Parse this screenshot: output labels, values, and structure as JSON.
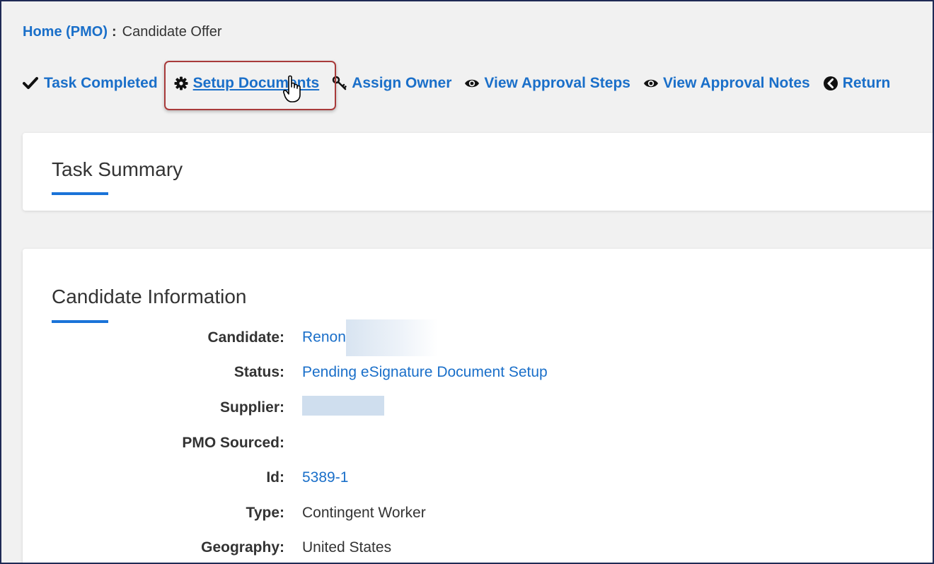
{
  "breadcrumb": {
    "home_label": "Home (PMO)",
    "separator": ":",
    "current": "Candidate Offer"
  },
  "actions": [
    {
      "label": "Task Completed",
      "icon": "checkmark-icon"
    },
    {
      "label": "Setup Documents",
      "icon": "gear-icon"
    },
    {
      "label": "Assign Owner",
      "icon": "key-icon"
    },
    {
      "label": "View Approval Steps",
      "icon": "eye-icon"
    },
    {
      "label": "View Approval Notes",
      "icon": "eye-icon"
    },
    {
      "label": "Return",
      "icon": "arrow-left-circle-icon"
    }
  ],
  "task_summary": {
    "title": "Task Summary"
  },
  "candidate_info": {
    "title": "Candidate Information",
    "fields": [
      {
        "label": "Candidate:",
        "value": "Renon"
      },
      {
        "label": "Status:",
        "value": "Pending eSignature Document Setup"
      },
      {
        "label": "Supplier:",
        "value": ""
      },
      {
        "label": "PMO Sourced:",
        "value": ""
      },
      {
        "label": "Id:",
        "value": "5389-1"
      },
      {
        "label": "Type:",
        "value": "Contingent Worker"
      },
      {
        "label": "Geography:",
        "value": "United States"
      }
    ]
  },
  "colors": {
    "link": "#1a6fc9",
    "accent_underline": "#1a73d8",
    "highlight_border": "#a83a3a",
    "page_background": "#f1f1f1"
  }
}
